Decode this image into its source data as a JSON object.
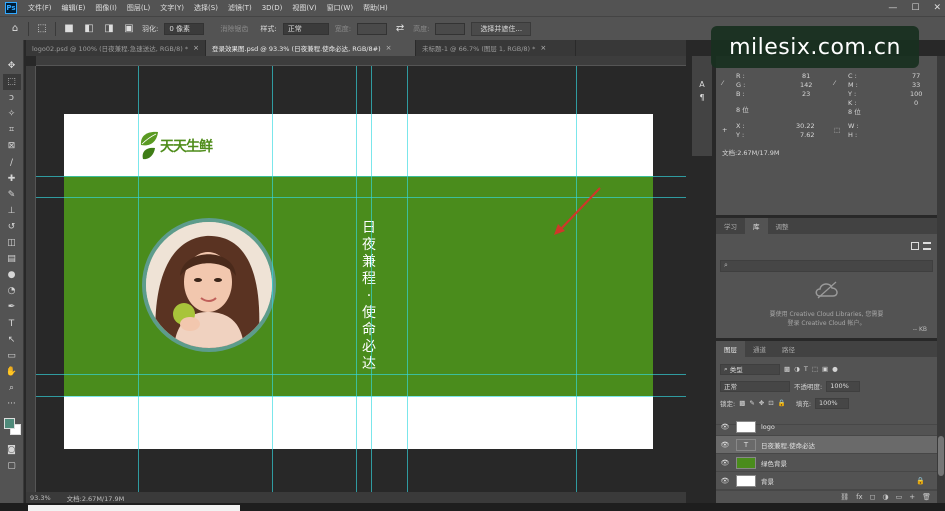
{
  "menu": {
    "items": [
      "文件(F)",
      "编辑(E)",
      "图像(I)",
      "图层(L)",
      "文字(Y)",
      "选择(S)",
      "滤镜(T)",
      "3D(D)",
      "视图(V)",
      "窗口(W)",
      "帮助(H)"
    ],
    "window_controls": [
      "—",
      "☐",
      "✕"
    ]
  },
  "options": {
    "feather_label": "羽化:",
    "feather_value": "0 像素",
    "antialias_label": "消除锯齿",
    "style_label": "样式:",
    "style_value": "正常",
    "width_label": "宽度:",
    "height_label": "高度:",
    "select_mask_button": "选择并遮住..."
  },
  "tabs": [
    {
      "label": "logo02.psd @ 100% (日夜兼程.急速送达, RGB/8) *",
      "close": "×",
      "active": false
    },
    {
      "label": "登录效果图.psd @ 93.3% (日夜兼程.使命必达, RGB/8#)",
      "close": "×",
      "active": true
    },
    {
      "label": "未标题-1 @ 66.7% (图层 1, RGB/8) *",
      "close": "×",
      "active": false
    }
  ],
  "document": {
    "logo_text": "天天生鲜",
    "slogan": [
      "日",
      "夜",
      "兼",
      "程",
      "·",
      "使",
      "命",
      "必",
      "达"
    ]
  },
  "status": {
    "zoom": "93.3%",
    "doc_size": "文档:2.67M/17.9M"
  },
  "watermark": "milesix.com.cn",
  "info": {
    "r_label": "R :",
    "r_value": "81",
    "g_label": "G :",
    "g_value": "142",
    "b_label": "B :",
    "b_value": "23",
    "c_label": "C :",
    "c_value": "77",
    "m_label": "M :",
    "m_value": "33",
    "y_label": "Y :",
    "y_value": "100",
    "k_label": "K :",
    "k_value": "0",
    "bit_left": "8 位",
    "bit_right": "8 位",
    "x_label": "X :",
    "x_value": "30.22",
    "yy_label": "Y :",
    "yy_value": "7.62",
    "w_label": "W :",
    "h_label": "H :",
    "doc_size": "文档:2.67M/17.9M"
  },
  "library": {
    "tabs": [
      "学习",
      "库",
      "调整"
    ],
    "search_icon": "⌕",
    "message_line1": "要使用 Creative Cloud Libraries, 您需要",
    "message_line2": "登录 Creative Cloud 帐户。",
    "kb": "-- KB"
  },
  "layers": {
    "tabs": [
      "图层",
      "通道",
      "路径"
    ],
    "kind_label": "类型",
    "blend_mode": "正常",
    "opacity_label": "不透明度:",
    "opacity_value": "100%",
    "lock_label": "锁定:",
    "fill_label": "填充:",
    "fill_value": "100%",
    "items": [
      {
        "name": "logo",
        "thumb": "",
        "selected": false,
        "thumb_color": "#ffffff"
      },
      {
        "name": "日夜兼程.使命必达",
        "thumb": "T",
        "selected": true,
        "thumb_color": "#6a6a6a"
      },
      {
        "name": "绿色背景",
        "thumb": "",
        "selected": false,
        "thumb_color": "#4a8c1c"
      },
      {
        "name": "背景",
        "thumb": "",
        "selected": false,
        "thumb_color": "#ffffff"
      }
    ],
    "footer_icons": [
      "fx",
      "◻",
      "◑",
      "▭",
      "+",
      "🗑"
    ]
  },
  "colors": {
    "brand_green": "#4a8c1c",
    "ring_teal": "#5d9c8c",
    "guide_cyan": "#34d8e0",
    "fg_swatch": "#4f8a7a",
    "bg_swatch": "#ffffff"
  }
}
